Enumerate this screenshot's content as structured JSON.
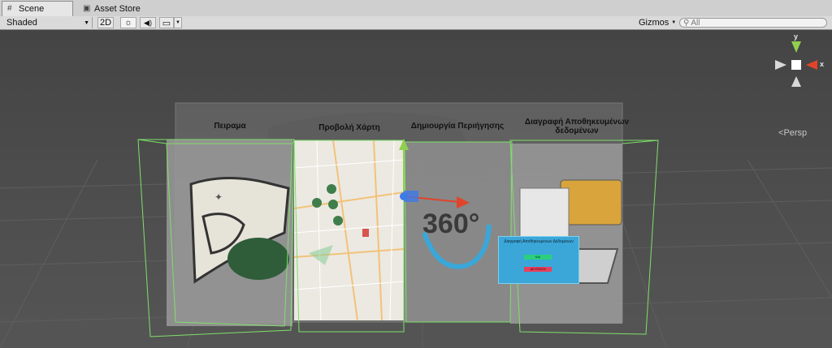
{
  "tabs": [
    {
      "label": "Scene",
      "icon": "grid-icon"
    },
    {
      "label": "Asset Store",
      "icon": "store-icon"
    }
  ],
  "toolbar": {
    "shading_mode": "Shaded",
    "mode_2d": "2D",
    "gizmos_label": "Gizmos",
    "search_placeholder": "All"
  },
  "scene": {
    "panels": [
      {
        "title": "Πειραμα"
      },
      {
        "title": "Προβολή Χάρτη"
      },
      {
        "title": "Δημιουργία Περιήγησης"
      },
      {
        "title": "Διαγραφή Αποθηκευμένων δεδομένων"
      }
    ],
    "icon_360_text": "360°",
    "delete_dialog": {
      "title": "Διαγραφή Αποθηκευμένων Δεδομένων",
      "yes": "NAI",
      "no": "ΑΚΥΡΩΣΗ"
    },
    "gizmo": {
      "y": "y",
      "x": "x",
      "projection": "Persp"
    }
  },
  "colors": {
    "selection_green": "#7ee06a",
    "axis_y": "#8fd14f",
    "axis_x": "#e0442a",
    "axis_z": "#3d7be8"
  }
}
